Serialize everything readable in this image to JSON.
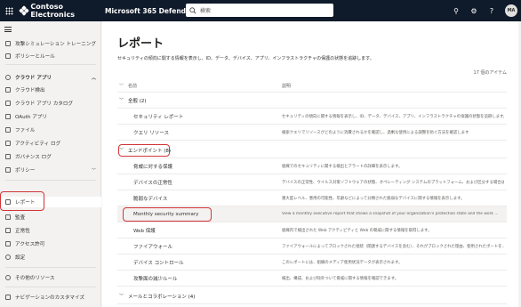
{
  "topbar": {
    "brand": "Contoso Electronics",
    "app": "Microsoft 365 Defender",
    "search_placeholder": "検索",
    "avatar": "MA"
  },
  "sidebar": {
    "items": [
      {
        "label": "攻撃シミュレーション トレーニング"
      },
      {
        "label": "ポリシーとルール"
      },
      {
        "label": "クラウド アプリ"
      },
      {
        "label": "クラウド検出"
      },
      {
        "label": "クラウド アプリ カタログ"
      },
      {
        "label": "OAuth アプリ"
      },
      {
        "label": "ファイル"
      },
      {
        "label": "アクティビティ ログ"
      },
      {
        "label": "ガバナンス ログ"
      },
      {
        "label": "ポリシー"
      },
      {
        "label": "レポート"
      },
      {
        "label": "監査"
      },
      {
        "label": "正常性"
      },
      {
        "label": "アクセス許可"
      },
      {
        "label": "設定"
      },
      {
        "label": "その他のリソース"
      },
      {
        "label": "ナビゲーションのカスタマイズ"
      }
    ]
  },
  "main": {
    "title": "レポート",
    "description": "セキュリティの傾向に関する情報を表示し、ID、データ、デバイス、アプリ、インフラストラクチャの保護の状態を追跡します。",
    "count": "17 個のアイテム",
    "columns": {
      "name": "名前",
      "description": "説明"
    },
    "groups": {
      "general": "全般 (2)",
      "endpoints": "エンドポイント (8)",
      "email": "メールとコラボレーション (4)"
    },
    "rows": [
      {
        "name": "セキュリティ レポート",
        "desc": "セキュリティの傾向に関する情報を表示し、ID、データ、デバイス、アプリ、インフラストラクチャの保護の状態を追跡します。"
      },
      {
        "name": "クエリ リソース",
        "desc": "検索クエリでリソースがどのように消費されるかを確認し、過剰な使用による調整を防ぐ方法を確認します"
      },
      {
        "name": "脅威に対する保護",
        "desc": "組織でのセキュリティに関する検出とアラートの詳細を表示します。"
      },
      {
        "name": "デバイスの正常性",
        "desc": "デバイスの正常性、ウイルス対策ソフトウェアの状態、オペレーティング システムのプラットフォーム、および区分する場合は Win..."
      },
      {
        "name": "脆弱なデバイス",
        "desc": "重大度レベル、悪用の可能性、年齢などによって分類された脆弱なデバイスに関する情報を表示します。"
      },
      {
        "name": "Monthly security summary",
        "desc": "View a monthly executive report that shows a snapshot of your organization's protection state and the work ..."
      },
      {
        "name": "Web 保護",
        "desc": "組織内で検出された Web アクティビティと Web の脅威に関する情報を取得します。"
      },
      {
        "name": "ファイアウォール",
        "desc": "ファイアウォールによってブロックされた接続（関連するデバイスを含む）、それがブロックされた理由、使用されたポートを..."
      },
      {
        "name": "デバイス コントロール",
        "desc": "このレポートには、組織のメディア使用状況データが表示されます。"
      },
      {
        "name": "攻撃面の減少ルール",
        "desc": "検出、構成、および除外ついて脅威に関する情報を確認できます。"
      }
    ]
  }
}
